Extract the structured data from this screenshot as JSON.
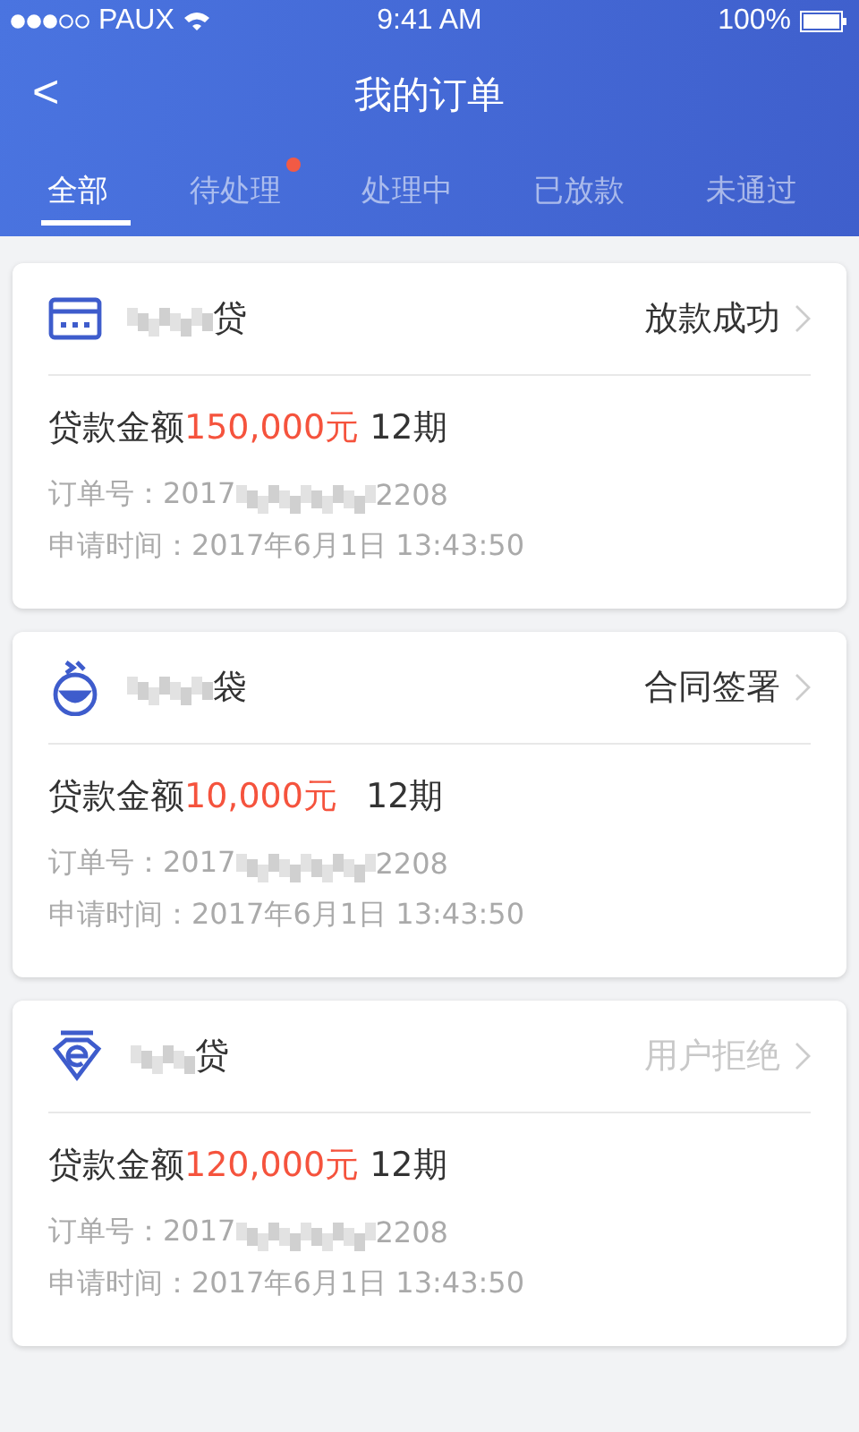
{
  "status_bar": {
    "carrier": "PAUX",
    "time": "9:41 AM",
    "battery": "100%"
  },
  "nav": {
    "back": "<",
    "title": "我的订单"
  },
  "tabs": [
    {
      "label": "全部",
      "selected": true,
      "badge": false
    },
    {
      "label": "待处理",
      "selected": false,
      "badge": true
    },
    {
      "label": "处理中",
      "selected": false,
      "badge": false
    },
    {
      "label": "已放款",
      "selected": false,
      "badge": false
    },
    {
      "label": "未通过",
      "selected": false,
      "badge": false
    }
  ],
  "orders": [
    {
      "kind": "card",
      "name": "贷",
      "status": "放款成功",
      "status_muted": false,
      "amount_label": "贷款金额",
      "amount": "150,000元",
      "term": "12期",
      "order_label": "订单号：2017",
      "order_tail": "2208",
      "time": "申请时间：2017年6月1日 13:43:50"
    },
    {
      "kind": "flask",
      "name": "袋",
      "status": "合同签署",
      "status_muted": false,
      "amount_label": "贷款金额",
      "amount": "10,000元",
      "term": "12期",
      "order_label": "订单号：2017",
      "order_tail": "2208",
      "time": "申请时间：2017年6月1日 13:43:50"
    },
    {
      "kind": "gem",
      "name": "贷",
      "status": "用户拒绝",
      "status_muted": true,
      "amount_label": "贷款金额",
      "amount": "120,000元",
      "term": "12期",
      "order_label": "订单号：2017",
      "order_tail": "2208",
      "time": "申请时间：2017年6月1日 13:43:50"
    }
  ]
}
